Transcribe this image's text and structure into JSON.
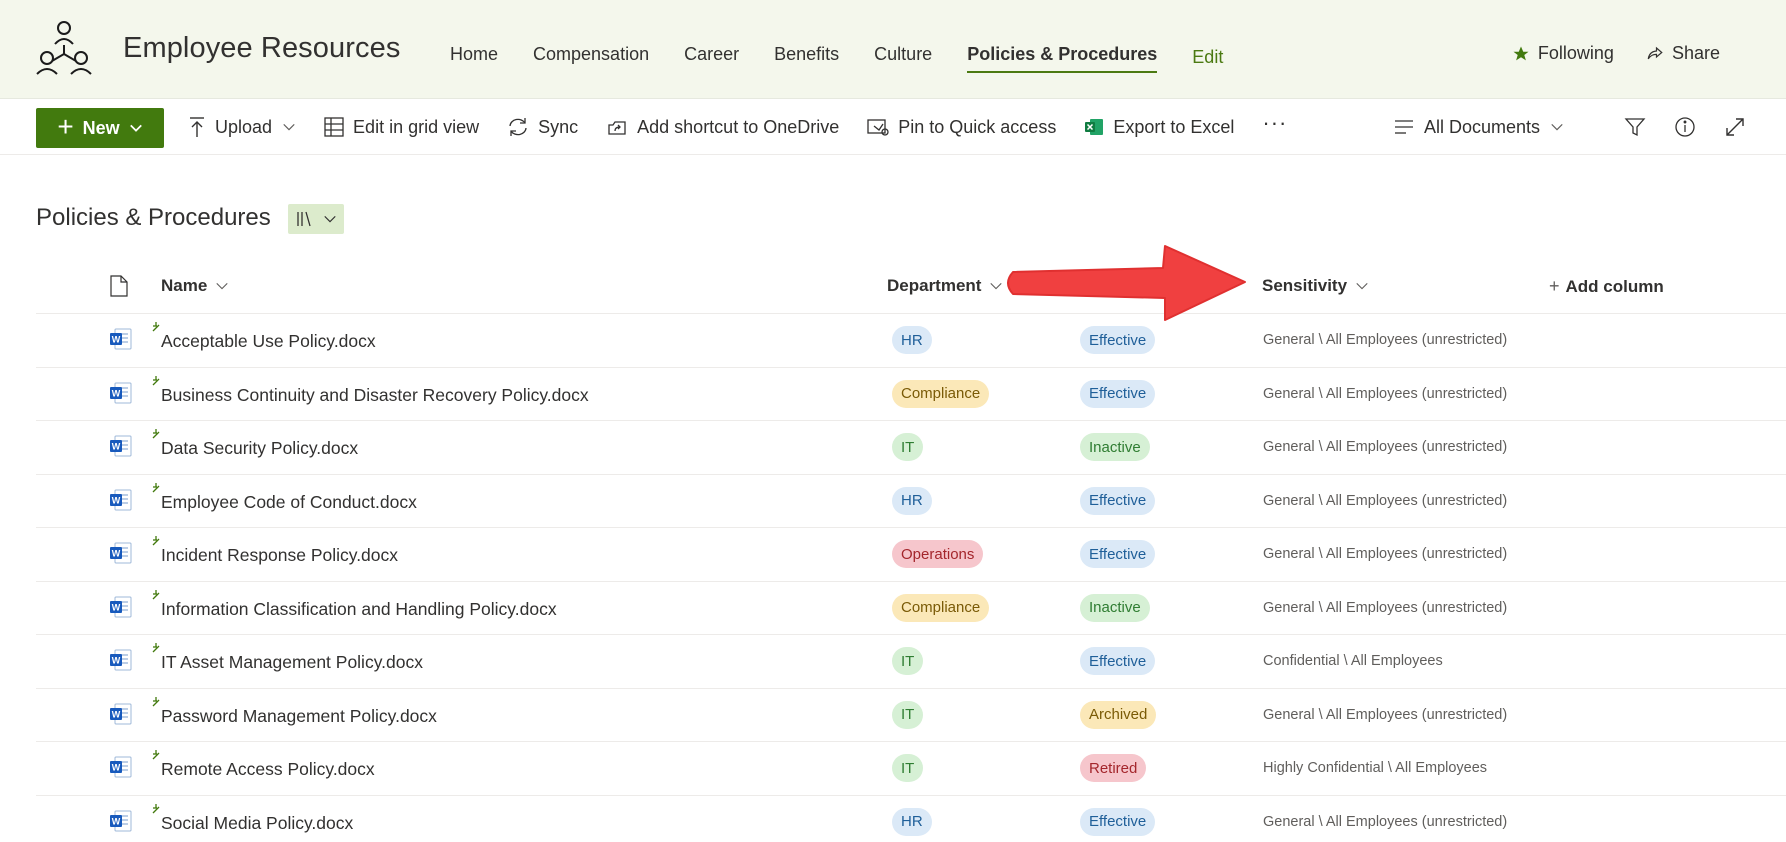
{
  "site": {
    "title": "Employee Resources",
    "nav": [
      {
        "label": "Home"
      },
      {
        "label": "Compensation"
      },
      {
        "label": "Career"
      },
      {
        "label": "Benefits"
      },
      {
        "label": "Culture"
      },
      {
        "label": "Policies & Procedures",
        "active": true
      }
    ],
    "edit_label": "Edit",
    "following_label": "Following",
    "share_label": "Share"
  },
  "command_bar": {
    "new_label": "New",
    "upload_label": "Upload",
    "grid_label": "Edit in grid view",
    "sync_label": "Sync",
    "shortcut_label": "Add shortcut to OneDrive",
    "pin_label": "Pin to Quick access",
    "export_label": "Export to Excel",
    "more_label": "···",
    "view_label": "All Documents"
  },
  "library": {
    "title": "Policies & Procedures"
  },
  "table": {
    "columns": {
      "name": "Name",
      "department": "Department",
      "sensitivity": "Sensitivity",
      "add_column": "Add column"
    },
    "rows": [
      {
        "name": "Acceptable Use Policy.docx",
        "department": "HR",
        "status": "Effective",
        "sensitivity": "General \\ All Employees (unrestricted)"
      },
      {
        "name": "Business Continuity and Disaster Recovery Policy.docx",
        "department": "Compliance",
        "status": "Effective",
        "sensitivity": "General \\ All Employees (unrestricted)"
      },
      {
        "name": "Data Security Policy.docx",
        "department": "IT",
        "status": "Inactive",
        "sensitivity": "General \\ All Employees (unrestricted)"
      },
      {
        "name": "Employee Code of Conduct.docx",
        "department": "HR",
        "status": "Effective",
        "sensitivity": "General \\ All Employees (unrestricted)"
      },
      {
        "name": "Incident Response Policy.docx",
        "department": "Operations",
        "status": "Effective",
        "sensitivity": "General \\ All Employees (unrestricted)"
      },
      {
        "name": "Information Classification and Handling Policy.docx",
        "department": "Compliance",
        "status": "Inactive",
        "sensitivity": "General \\ All Employees (unrestricted)"
      },
      {
        "name": "IT Asset Management Policy.docx",
        "department": "IT",
        "status": "Effective",
        "sensitivity": "Confidential \\ All Employees"
      },
      {
        "name": "Password Management Policy.docx",
        "department": "IT",
        "status": "Archived",
        "sensitivity": "General \\ All Employees (unrestricted)"
      },
      {
        "name": "Remote Access Policy.docx",
        "department": "IT",
        "status": "Retired",
        "sensitivity": "Highly Confidential \\ All Employees"
      },
      {
        "name": "Social Media Policy.docx",
        "department": "HR",
        "status": "Effective",
        "sensitivity": "General \\ All Employees (unrestricted)"
      }
    ]
  },
  "pill_colors": {
    "HR": {
      "bg": "#dbe9f7",
      "fg": "#1f5f99"
    },
    "Compliance": {
      "bg": "#fbe8b8",
      "fg": "#7a5a06"
    },
    "IT": {
      "bg": "#d6f0d5",
      "fg": "#2f7d32"
    },
    "Operations": {
      "bg": "#f6c6cc",
      "fg": "#a4262c"
    },
    "Effective": {
      "bg": "#dbe9f7",
      "fg": "#1f5f99"
    },
    "Inactive": {
      "bg": "#d6f0d5",
      "fg": "#2f7d32"
    },
    "Archived": {
      "bg": "#fbe8b8",
      "fg": "#7a5a06"
    },
    "Retired": {
      "bg": "#f6c6cc",
      "fg": "#a4262c"
    }
  },
  "colors": {
    "accent": "#427a0e",
    "header_bg": "#f4f7ec",
    "annotation_arrow": "#f04040"
  },
  "icons": {
    "logo": "people-network-icon",
    "following": "star-icon",
    "share": "share-icon",
    "file_type": "word-doc-icon"
  }
}
